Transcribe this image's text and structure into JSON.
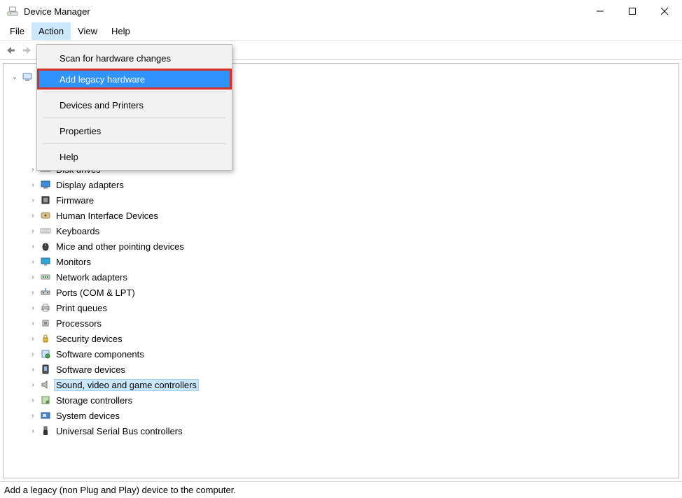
{
  "window": {
    "title": "Device Manager"
  },
  "menu": {
    "items": [
      "File",
      "Action",
      "View",
      "Help"
    ],
    "active_index": 1
  },
  "action_menu": {
    "items": [
      "Scan for hardware changes",
      "Add legacy hardware",
      "Devices and Printers",
      "Properties",
      "Help"
    ],
    "highlighted_index": 1
  },
  "tree": {
    "root_expanded_glyph": "⌄",
    "child_expander_glyph": "›",
    "categories": [
      {
        "label": "Disk drives",
        "icon": "disk"
      },
      {
        "label": "Display adapters",
        "icon": "display"
      },
      {
        "label": "Firmware",
        "icon": "firmware"
      },
      {
        "label": "Human Interface Devices",
        "icon": "hid"
      },
      {
        "label": "Keyboards",
        "icon": "keyboard"
      },
      {
        "label": "Mice and other pointing devices",
        "icon": "mouse"
      },
      {
        "label": "Monitors",
        "icon": "monitor"
      },
      {
        "label": "Network adapters",
        "icon": "network"
      },
      {
        "label": "Ports (COM & LPT)",
        "icon": "ports"
      },
      {
        "label": "Print queues",
        "icon": "printer"
      },
      {
        "label": "Processors",
        "icon": "cpu"
      },
      {
        "label": "Security devices",
        "icon": "security"
      },
      {
        "label": "Software components",
        "icon": "swcomp"
      },
      {
        "label": "Software devices",
        "icon": "swdev"
      },
      {
        "label": "Sound, video and game controllers",
        "icon": "sound",
        "selected": true
      },
      {
        "label": "Storage controllers",
        "icon": "storage"
      },
      {
        "label": "System devices",
        "icon": "system"
      },
      {
        "label": "Universal Serial Bus controllers",
        "icon": "usb"
      }
    ]
  },
  "statusbar": {
    "text": "Add a legacy (non Plug and Play) device to the computer."
  }
}
